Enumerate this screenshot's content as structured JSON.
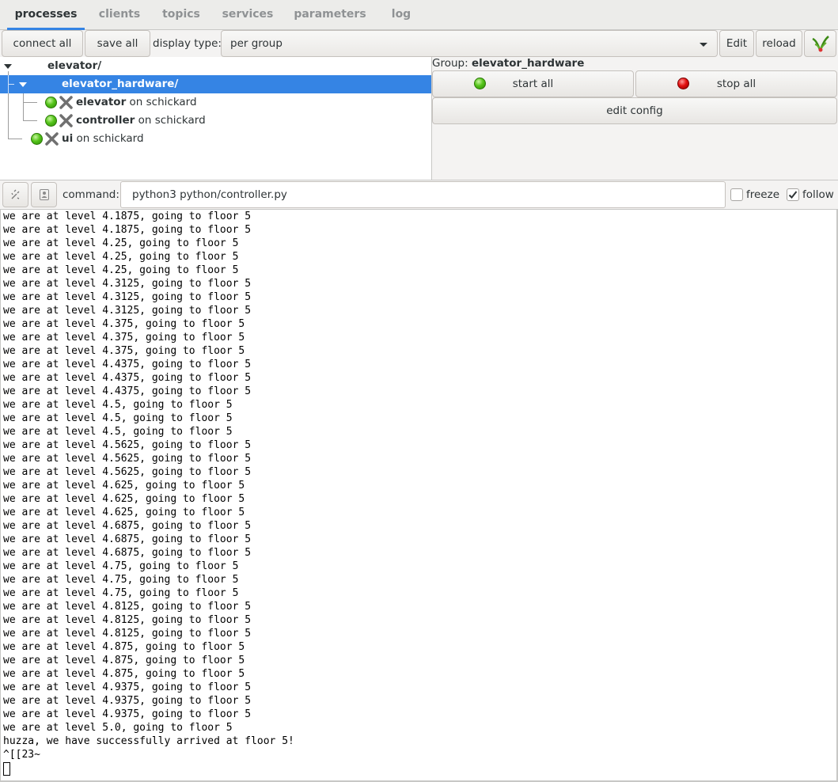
{
  "tabs": [
    {
      "label": "processes",
      "active": true
    },
    {
      "label": "clients",
      "active": false
    },
    {
      "label": "topics",
      "active": false
    },
    {
      "label": "services",
      "active": false
    },
    {
      "label": "parameters",
      "active": false
    },
    {
      "label": "log",
      "active": false
    }
  ],
  "toolbar": {
    "connect_all": "connect all",
    "save_all": "save all",
    "display_type_label": "display type:",
    "display_type_value": "per group",
    "edit": "Edit",
    "reload": "reload",
    "app_icon": "leaf-logo-icon"
  },
  "tree": {
    "root": {
      "label": "elevator/"
    },
    "group": {
      "label": "elevator_hardware/"
    },
    "items": [
      {
        "name": "elevator",
        "host": " on schickard",
        "status": "green"
      },
      {
        "name": "controller",
        "host": " on schickard",
        "status": "green"
      },
      {
        "name": "ui",
        "host": " on schickard",
        "status": "green"
      }
    ]
  },
  "group_panel": {
    "prefix": "Group: ",
    "name": "elevator_hardware",
    "start_all": "start all",
    "stop_all": "stop all",
    "edit_config": "edit config"
  },
  "command_bar": {
    "label": "command:",
    "value": "python3 python/controller.py",
    "freeze_label": "freeze",
    "freeze_checked": false,
    "follow_label": "follow",
    "follow_checked": true
  },
  "log_lines": [
    "we are at level 4.1875, going to floor 5",
    "we are at level 4.1875, going to floor 5",
    "we are at level 4.25, going to floor 5",
    "we are at level 4.25, going to floor 5",
    "we are at level 4.25, going to floor 5",
    "we are at level 4.3125, going to floor 5",
    "we are at level 4.3125, going to floor 5",
    "we are at level 4.3125, going to floor 5",
    "we are at level 4.375, going to floor 5",
    "we are at level 4.375, going to floor 5",
    "we are at level 4.375, going to floor 5",
    "we are at level 4.4375, going to floor 5",
    "we are at level 4.4375, going to floor 5",
    "we are at level 4.4375, going to floor 5",
    "we are at level 4.5, going to floor 5",
    "we are at level 4.5, going to floor 5",
    "we are at level 4.5, going to floor 5",
    "we are at level 4.5625, going to floor 5",
    "we are at level 4.5625, going to floor 5",
    "we are at level 4.5625, going to floor 5",
    "we are at level 4.625, going to floor 5",
    "we are at level 4.625, going to floor 5",
    "we are at level 4.625, going to floor 5",
    "we are at level 4.6875, going to floor 5",
    "we are at level 4.6875, going to floor 5",
    "we are at level 4.6875, going to floor 5",
    "we are at level 4.75, going to floor 5",
    "we are at level 4.75, going to floor 5",
    "we are at level 4.75, going to floor 5",
    "we are at level 4.8125, going to floor 5",
    "we are at level 4.8125, going to floor 5",
    "we are at level 4.8125, going to floor 5",
    "we are at level 4.875, going to floor 5",
    "we are at level 4.875, going to floor 5",
    "we are at level 4.875, going to floor 5",
    "we are at level 4.9375, going to floor 5",
    "we are at level 4.9375, going to floor 5",
    "we are at level 4.9375, going to floor 5",
    "we are at level 5.0, going to floor 5",
    "huzza, we have successfully arrived at floor 5!",
    "^[[23~"
  ],
  "colors": {
    "accent": "#3584e4",
    "status_green": "#55c41a",
    "status_red": "#e31010"
  }
}
